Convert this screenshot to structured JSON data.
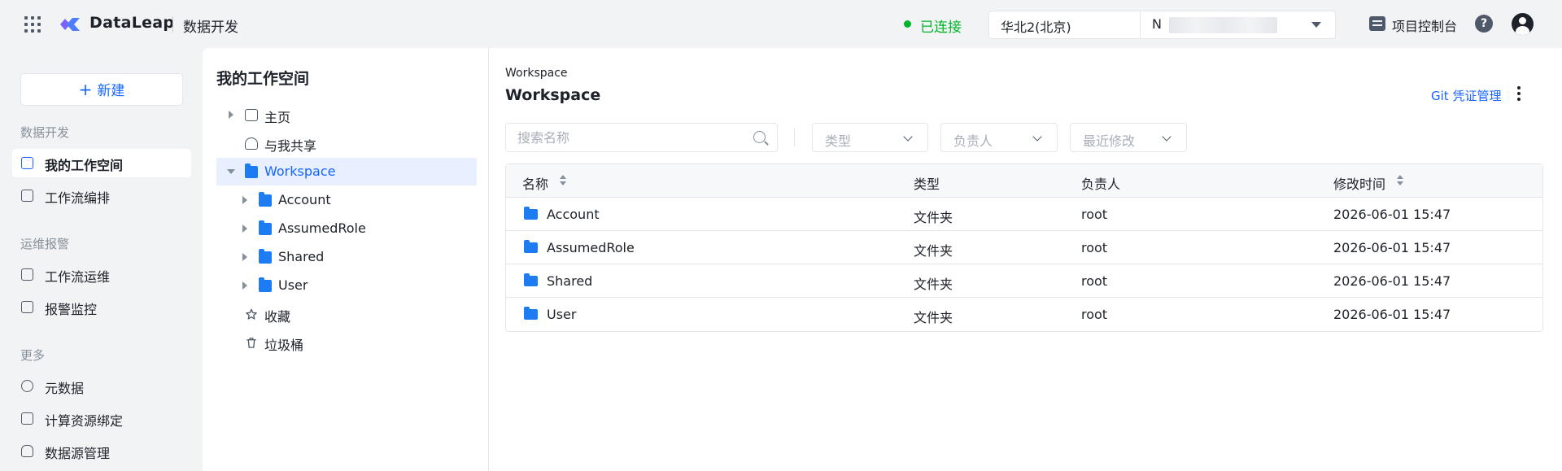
{
  "header": {
    "brand": "DataLeap",
    "module": "数据开发",
    "connection_status": "已连接",
    "region": "华北2(北京)",
    "account_prefix": "N",
    "console": "项目控制台",
    "help": "?"
  },
  "leftnav": {
    "new_label": "新建",
    "new_icon": "+",
    "sections": [
      {
        "title": "数据开发",
        "items": [
          "我的工作空间",
          "工作流编排"
        ]
      },
      {
        "title": "运维报警",
        "items": [
          "工作流运维",
          "报警监控"
        ]
      },
      {
        "title": "更多",
        "items": [
          "元数据",
          "计算资源绑定",
          "数据源管理"
        ]
      }
    ]
  },
  "tree": {
    "title": "我的工作空间",
    "items": [
      {
        "label": "主页",
        "icon": "home-icon"
      },
      {
        "label": "与我共享",
        "icon": "users-icon"
      },
      {
        "label": "Workspace",
        "icon": "folder-icon"
      },
      {
        "label": "Account",
        "icon": "folder-icon"
      },
      {
        "label": "AssumedRole",
        "icon": "folder-icon"
      },
      {
        "label": "Shared",
        "icon": "folder-icon"
      },
      {
        "label": "User",
        "icon": "folder-icon"
      },
      {
        "label": "收藏",
        "icon": "star-icon"
      },
      {
        "label": "垃圾桶",
        "icon": "trash-icon"
      }
    ]
  },
  "main": {
    "breadcrumb": "Workspace",
    "title": "Workspace",
    "git_link": "Git 凭证管理",
    "search_placeholder": "搜索名称",
    "filters": [
      "类型",
      "负责人",
      "最近修改"
    ],
    "columns": [
      "名称",
      "类型",
      "负责人",
      "修改时间"
    ],
    "rows": [
      {
        "name": "Account",
        "type": "文件夹",
        "owner": "root",
        "modified": "2026-06-01 15:47"
      },
      {
        "name": "AssumedRole",
        "type": "文件夹",
        "owner": "root",
        "modified": "2026-06-01 15:47"
      },
      {
        "name": "Shared",
        "type": "文件夹",
        "owner": "root",
        "modified": "2026-06-01 15:47"
      },
      {
        "name": "User",
        "type": "文件夹",
        "owner": "root",
        "modified": "2026-06-01 15:47"
      }
    ]
  },
  "colors": {
    "accent": "#1664ff",
    "connected": "#00b42a",
    "folder": "#1e7cf3"
  }
}
